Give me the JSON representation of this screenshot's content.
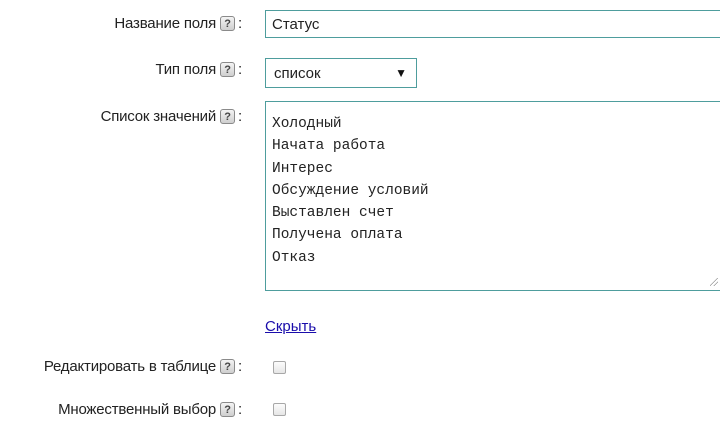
{
  "form": {
    "field_name": {
      "label": "Название поля",
      "help": "?",
      "colon": ":",
      "value": "Статус"
    },
    "field_type": {
      "label": "Тип поля",
      "help": "?",
      "colon": ":",
      "selected": "список",
      "arrow": "▼"
    },
    "values_list": {
      "label": "Список значений",
      "help": "?",
      "colon": ":",
      "items": [
        "Холодный",
        "Начата работа",
        "Интерес",
        "Обсуждение условий",
        "Выставлен счет",
        "Получена оплата",
        "Отказ"
      ]
    },
    "hide_link": "Скрыть",
    "edit_in_table": {
      "label": "Редактировать в таблице",
      "help": "?",
      "colon": ":",
      "checked": false
    },
    "multiple_choice": {
      "label": "Множественный выбор",
      "help": "?",
      "colon": ":",
      "checked": false
    }
  },
  "colors": {
    "input_border": "#4e9d9d",
    "link": "#1a0dab"
  }
}
